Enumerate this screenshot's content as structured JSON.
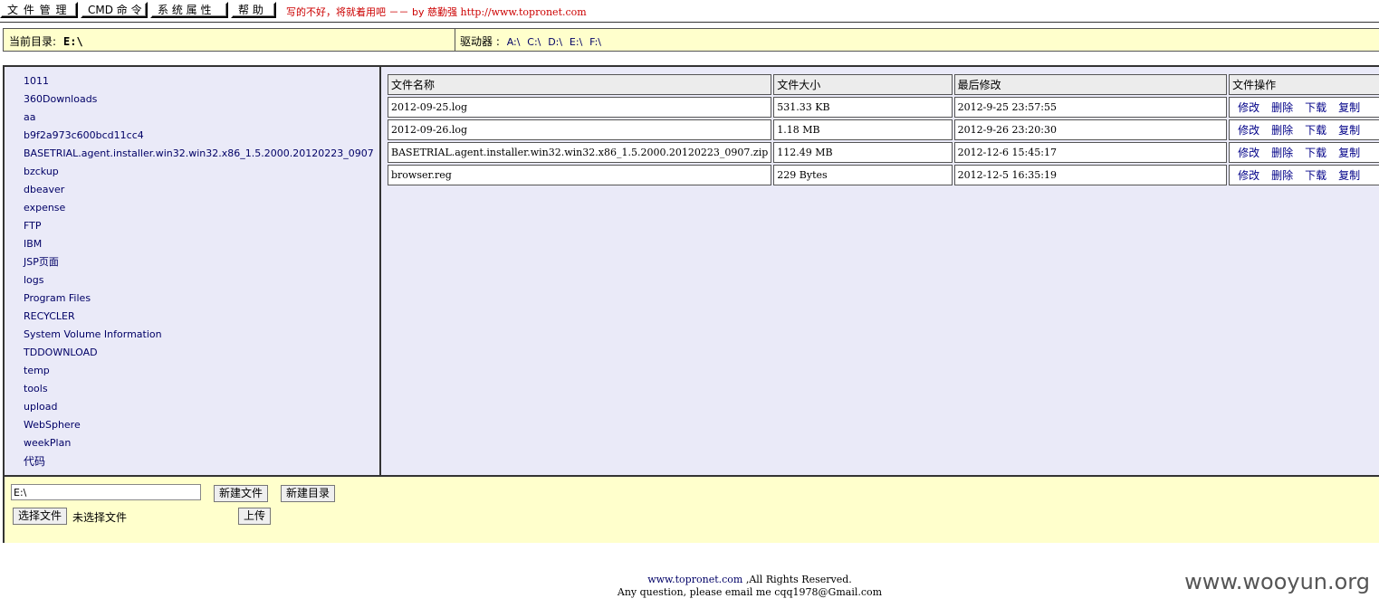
{
  "menu": {
    "items": [
      "文 件 管 理",
      "CMD 命 令",
      "系 统 属 性",
      "帮 助"
    ],
    "slogan_text": "写的不好，将就着用吧 －－ by 慈勤强",
    "slogan_url": "http://www.topronet.com"
  },
  "pathbar": {
    "current_label": "当前目录:",
    "current_value": "E:\\",
    "drives_label": "驱动器 :",
    "drives": [
      "A:\\",
      "C:\\",
      "D:\\",
      "E:\\",
      "F:\\"
    ]
  },
  "folders": [
    "1011",
    "360Downloads",
    "aa",
    "b9f2a973c600bcd11cc4",
    "BASETRIAL.agent.installer.win32.win32.x86_1.5.2000.20120223_0907",
    "bzckup",
    "dbeaver",
    "expense",
    "FTP",
    "IBM",
    "JSP页面",
    "logs",
    "Program Files",
    "RECYCLER",
    "System Volume Information",
    "TDDOWNLOAD",
    "temp",
    "tools",
    "upload",
    "WebSphere",
    "weekPlan",
    "代码"
  ],
  "file_table": {
    "headers": [
      "文件名称",
      "文件大小",
      "最后修改",
      "文件操作"
    ],
    "actions": [
      "修改",
      "删除",
      "下载",
      "复制"
    ],
    "rows": [
      {
        "name": "2012-09-25.log",
        "size": "531.33 KB",
        "modified": "2012-9-25 23:57:55"
      },
      {
        "name": "2012-09-26.log",
        "size": "1.18 MB",
        "modified": "2012-9-26 23:20:30"
      },
      {
        "name": "BASETRIAL.agent.installer.win32.win32.x86_1.5.2000.20120223_0907.zip",
        "size": "112.49 MB",
        "modified": "2012-12-6 15:45:17"
      },
      {
        "name": "browser.reg",
        "size": "229 Bytes",
        "modified": "2012-12-5 16:35:19"
      }
    ]
  },
  "bottom": {
    "path_value": "E:\\",
    "new_file": "新建文件",
    "new_dir": "新建目录",
    "choose_file": "选择文件",
    "no_file": "未选择文件",
    "upload": "上传"
  },
  "footer": {
    "link": "www.topronet.com",
    "rights": ",All Rights Reserved.",
    "contact": "Any question, please email me cqq1978@Gmail.com"
  },
  "watermark": "www.wooyun.org"
}
